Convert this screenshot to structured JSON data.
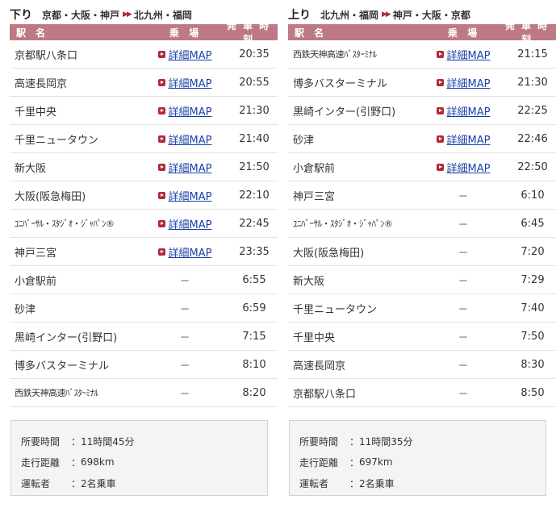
{
  "outbound": {
    "title": "下り",
    "from": "京都・大阪・神戸",
    "arrow": "▶▶",
    "to": "北九州・福岡",
    "headers": {
      "station": "駅 名",
      "boarding": "乗 場",
      "time": "発 車 時 刻"
    },
    "rows": [
      {
        "station": "京都駅八条口",
        "boarding": "詳細MAP",
        "time": "20:35"
      },
      {
        "station": "高速長岡京",
        "boarding": "詳細MAP",
        "time": "20:55"
      },
      {
        "station": "千里中央",
        "boarding": "詳細MAP",
        "time": "21:30"
      },
      {
        "station": "千里ニュータウン",
        "boarding": "詳細MAP",
        "time": "21:40"
      },
      {
        "station": "新大阪",
        "boarding": "詳細MAP",
        "time": "21:50"
      },
      {
        "station": "大阪(阪急梅田)",
        "boarding": "詳細MAP",
        "time": "22:10"
      },
      {
        "station": "ﾕﾆﾊﾞｰｻﾙ・ｽﾀｼﾞｵ・ｼﾞｬﾊﾟﾝ®",
        "boarding": "詳細MAP",
        "time": "22:45"
      },
      {
        "station": "神戸三宮",
        "boarding": "詳細MAP",
        "time": "23:35"
      },
      {
        "station": "小倉駅前",
        "boarding": "－",
        "time": "6:55"
      },
      {
        "station": "砂津",
        "boarding": "－",
        "time": "6:59"
      },
      {
        "station": "黒崎インター(引野口)",
        "boarding": "－",
        "time": "7:15"
      },
      {
        "station": "博多バスターミナル",
        "boarding": "－",
        "time": "8:10"
      },
      {
        "station": "西鉄天神高速ﾊﾞｽﾀｰﾐﾅﾙ",
        "boarding": "－",
        "time": "8:20"
      }
    ],
    "info": {
      "duration_label": "所要時間",
      "duration_value": "11時間45分",
      "distance_label": "走行距離",
      "distance_value": "698km",
      "drivers_label": "運転者",
      "drivers_value": "2名乗車"
    }
  },
  "inbound": {
    "title": "上り",
    "from": "北九州・福岡",
    "arrow": "▶▶",
    "to": "神戸・大阪・京都",
    "headers": {
      "station": "駅 名",
      "boarding": "乗 場",
      "time": "発 車 時 刻"
    },
    "rows": [
      {
        "station": "西鉄天神高速ﾊﾞｽﾀｰﾐﾅﾙ",
        "boarding": "詳細MAP",
        "time": "21:15"
      },
      {
        "station": "博多バスターミナル",
        "boarding": "詳細MAP",
        "time": "21:30"
      },
      {
        "station": "黒崎インター(引野口)",
        "boarding": "詳細MAP",
        "time": "22:25"
      },
      {
        "station": "砂津",
        "boarding": "詳細MAP",
        "time": "22:46"
      },
      {
        "station": "小倉駅前",
        "boarding": "詳細MAP",
        "time": "22:50"
      },
      {
        "station": "神戸三宮",
        "boarding": "－",
        "time": "6:10"
      },
      {
        "station": "ﾕﾆﾊﾞｰｻﾙ・ｽﾀｼﾞｵ・ｼﾞｬﾊﾟﾝ®",
        "boarding": "－",
        "time": "6:45"
      },
      {
        "station": "大阪(阪急梅田)",
        "boarding": "－",
        "time": "7:20"
      },
      {
        "station": "新大阪",
        "boarding": "－",
        "time": "7:29"
      },
      {
        "station": "千里ニュータウン",
        "boarding": "－",
        "time": "7:40"
      },
      {
        "station": "千里中央",
        "boarding": "－",
        "time": "7:50"
      },
      {
        "station": "高速長岡京",
        "boarding": "－",
        "time": "8:30"
      },
      {
        "station": "京都駅八条口",
        "boarding": "－",
        "time": "8:50"
      }
    ],
    "info": {
      "duration_label": "所要時間",
      "duration_value": "11時間35分",
      "distance_label": "走行距離",
      "distance_value": "697km",
      "drivers_label": "運転者",
      "drivers_value": "2名乗車"
    }
  },
  "colors": {
    "header_bg": "#bd7a84",
    "accent": "#b22a3b",
    "link": "#1a3fa8",
    "info_bg": "#f4f4f4"
  },
  "icons": {
    "map_link": "red-arrow-square-icon",
    "route_arrow": "double-arrow-icon"
  }
}
